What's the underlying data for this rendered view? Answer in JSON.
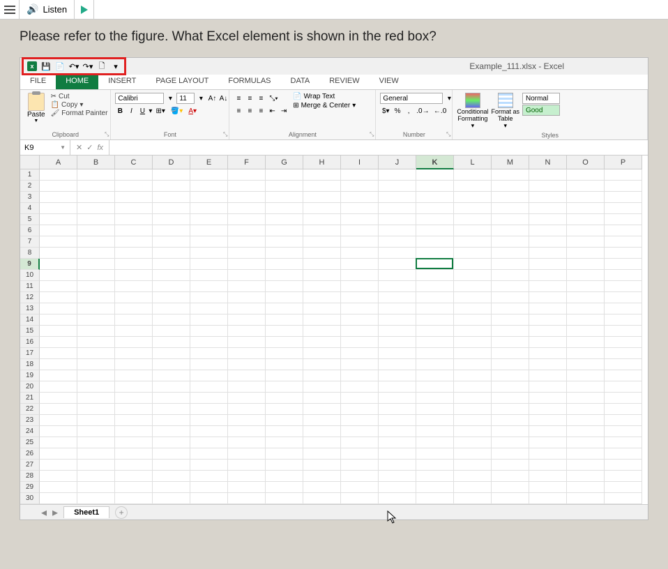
{
  "topbar": {
    "listen": "Listen"
  },
  "question": "Please refer to the figure.  What Excel element is shown in the red box?",
  "title": "Example_111.xlsx - Excel",
  "tabs": [
    "FILE",
    "HOME",
    "INSERT",
    "PAGE LAYOUT",
    "FORMULAS",
    "DATA",
    "REVIEW",
    "VIEW"
  ],
  "clipboard": {
    "paste": "Paste",
    "cut": "Cut",
    "copy": "Copy",
    "format_painter": "Format Painter",
    "label": "Clipboard"
  },
  "font": {
    "name": "Calibri",
    "size": "11",
    "label": "Font"
  },
  "alignment": {
    "wrap": "Wrap Text",
    "merge": "Merge & Center",
    "label": "Alignment"
  },
  "number": {
    "format": "General",
    "label": "Number"
  },
  "styles": {
    "cond": "Conditional\nFormatting",
    "fmt_table": "Format as\nTable",
    "normal": "Normal",
    "good": "Good",
    "label": "Styles"
  },
  "namebox": "K9",
  "columns": [
    "A",
    "B",
    "C",
    "D",
    "E",
    "F",
    "G",
    "H",
    "I",
    "J",
    "K",
    "L",
    "M",
    "N",
    "O",
    "P"
  ],
  "rows": [
    1,
    2,
    3,
    4,
    5,
    6,
    7,
    8,
    9,
    10,
    11,
    12,
    13,
    14,
    15,
    16,
    17,
    18,
    19,
    20,
    21,
    22,
    23,
    24,
    25,
    26,
    27,
    28,
    29,
    30
  ],
  "active": {
    "row": 9,
    "col": 10
  },
  "sheet": "Sheet1"
}
